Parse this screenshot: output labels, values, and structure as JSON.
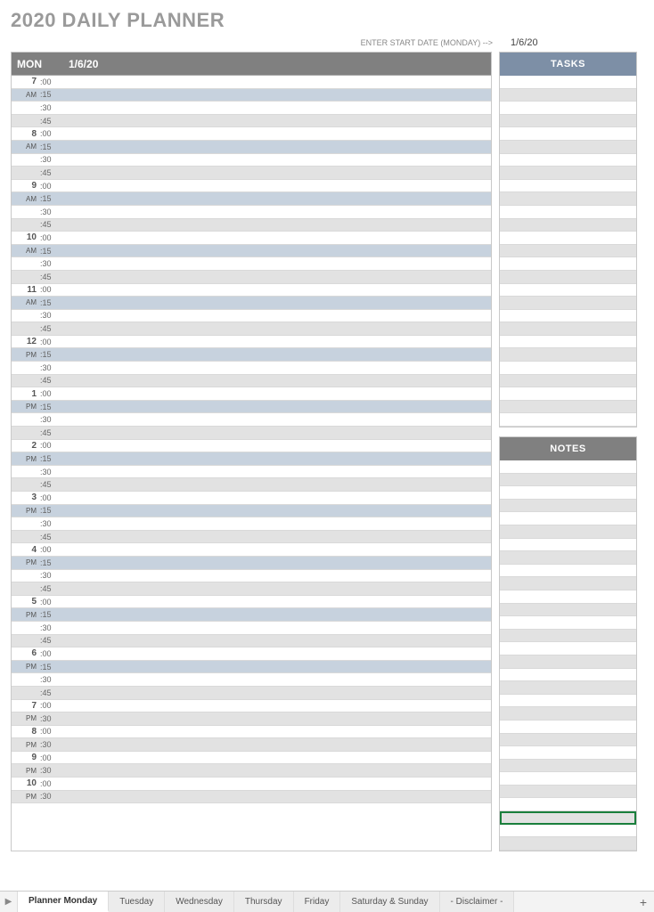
{
  "title": "2020 DAILY PLANNER",
  "start_date_prompt": "ENTER START DATE (MONDAY) -->",
  "start_date_value": "1/6/20",
  "schedule": {
    "day_label": "MON",
    "date": "1/6/20",
    "hours": [
      {
        "h": "7",
        "ampm": "AM",
        "minutes": [
          ":00",
          ":15",
          ":30",
          ":45"
        ]
      },
      {
        "h": "8",
        "ampm": "AM",
        "minutes": [
          ":00",
          ":15",
          ":30",
          ":45"
        ]
      },
      {
        "h": "9",
        "ampm": "AM",
        "minutes": [
          ":00",
          ":15",
          ":30",
          ":45"
        ]
      },
      {
        "h": "10",
        "ampm": "AM",
        "minutes": [
          ":00",
          ":15",
          ":30",
          ":45"
        ]
      },
      {
        "h": "11",
        "ampm": "AM",
        "minutes": [
          ":00",
          ":15",
          ":30",
          ":45"
        ]
      },
      {
        "h": "12",
        "ampm": "PM",
        "minutes": [
          ":00",
          ":15",
          ":30",
          ":45"
        ]
      },
      {
        "h": "1",
        "ampm": "PM",
        "minutes": [
          ":00",
          ":15",
          ":30",
          ":45"
        ]
      },
      {
        "h": "2",
        "ampm": "PM",
        "minutes": [
          ":00",
          ":15",
          ":30",
          ":45"
        ]
      },
      {
        "h": "3",
        "ampm": "PM",
        "minutes": [
          ":00",
          ":15",
          ":30",
          ":45"
        ]
      },
      {
        "h": "4",
        "ampm": "PM",
        "minutes": [
          ":00",
          ":15",
          ":30",
          ":45"
        ]
      },
      {
        "h": "5",
        "ampm": "PM",
        "minutes": [
          ":00",
          ":15",
          ":30",
          ":45"
        ]
      },
      {
        "h": "6",
        "ampm": "PM",
        "minutes": [
          ":00",
          ":15",
          ":30",
          ":45"
        ]
      },
      {
        "h": "7",
        "ampm": "PM",
        "minutes": [
          ":00",
          ":30"
        ]
      },
      {
        "h": "8",
        "ampm": "PM",
        "minutes": [
          ":00",
          ":30"
        ]
      },
      {
        "h": "9",
        "ampm": "PM",
        "minutes": [
          ":00",
          ":30"
        ]
      },
      {
        "h": "10",
        "ampm": "PM",
        "minutes": [
          ":00",
          ":30"
        ]
      }
    ]
  },
  "tasks": {
    "header": "TASKS",
    "rows": 27
  },
  "notes": {
    "header": "NOTES",
    "rows": 30,
    "selected_index": 27
  },
  "tabs": {
    "items": [
      {
        "label": "Planner Monday",
        "active": true
      },
      {
        "label": "Tuesday",
        "active": false
      },
      {
        "label": "Wednesday",
        "active": false
      },
      {
        "label": "Thursday",
        "active": false
      },
      {
        "label": "Friday",
        "active": false
      },
      {
        "label": "Saturday & Sunday",
        "active": false
      },
      {
        "label": "- Disclaimer -",
        "active": false
      }
    ],
    "nav_glyph": "▶",
    "add_glyph": "+"
  }
}
